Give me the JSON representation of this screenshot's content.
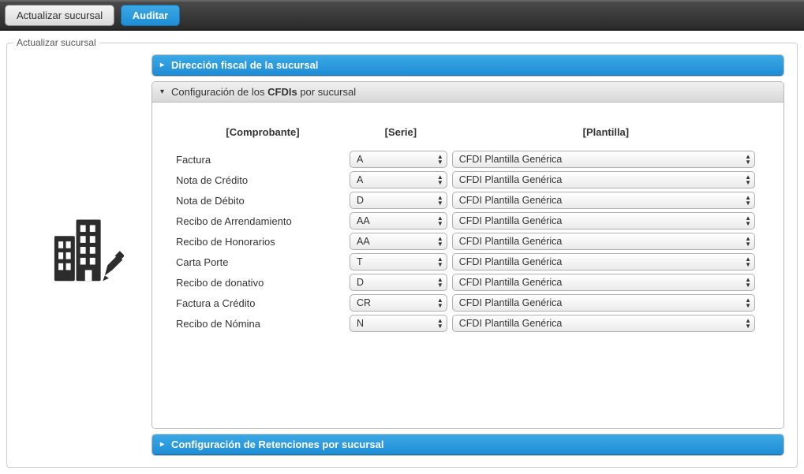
{
  "tabs": {
    "update": "Actualizar sucursal",
    "audit": "Auditar"
  },
  "fieldset_legend": "Actualizar sucursal",
  "panels": {
    "direccion": {
      "title": "Dirección fiscal de la sucursal"
    },
    "cfdi": {
      "title_prefix": "Configuración de los ",
      "title_bold": "CFDIs",
      "title_suffix": " por sucursal"
    },
    "retenciones": {
      "title_prefix": "Configuración de ",
      "title_bold": "Retenciones",
      "title_suffix": " por sucursal"
    }
  },
  "headers": {
    "comprobante": "[Comprobante]",
    "serie": "[Serie]",
    "plantilla": "[Plantilla]"
  },
  "rows": [
    {
      "label": "Factura",
      "serie": "A",
      "plantilla": "CFDI Plantilla Genérica"
    },
    {
      "label": "Nota de Crédito",
      "serie": "A",
      "plantilla": "CFDI Plantilla Genérica"
    },
    {
      "label": "Nota de Débito",
      "serie": "D",
      "plantilla": "CFDI Plantilla Genérica"
    },
    {
      "label": "Recibo de Arrendamiento",
      "serie": "AA",
      "plantilla": "CFDI Plantilla Genérica"
    },
    {
      "label": "Recibo de Honorarios",
      "serie": "AA",
      "plantilla": "CFDI Plantilla Genérica"
    },
    {
      "label": "Carta Porte",
      "serie": "T",
      "plantilla": "CFDI Plantilla Genérica"
    },
    {
      "label": "Recibo de donativo",
      "serie": "D",
      "plantilla": "CFDI Plantilla Genérica"
    },
    {
      "label": "Factura a Crédito",
      "serie": "CR",
      "plantilla": "CFDI Plantilla Genérica"
    },
    {
      "label": "Recibo de Nómina",
      "serie": "N",
      "plantilla": "CFDI Plantilla Genérica"
    }
  ]
}
